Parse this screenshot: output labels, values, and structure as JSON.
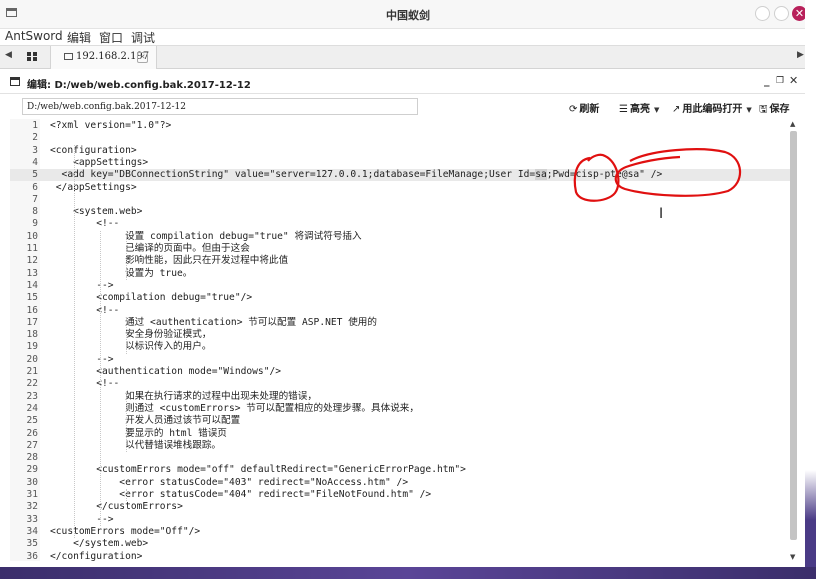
{
  "window": {
    "title": "中国蚁剑"
  },
  "menu": [
    "AntSword",
    "编辑",
    "窗口",
    "调试"
  ],
  "tabs": {
    "host": "192.168.2.197"
  },
  "editor": {
    "title": "编辑: D:/web/web.config.bak.2017-12-12",
    "min_label": "_",
    "max_label": "❐",
    "close_label": "✕",
    "path_value": "D:/web/web.config.bak.2017-12-12",
    "buttons": {
      "refresh": "刷新",
      "highlight": "高亮",
      "open_with_encoding": "用此编码打开",
      "save": "保存"
    },
    "line_numbers": [
      "1",
      "2",
      "3",
      "4",
      "5",
      "6",
      "7",
      "8",
      "9",
      "10",
      "11",
      "12",
      "13",
      "14",
      "15",
      "16",
      "17",
      "18",
      "19",
      "20",
      "21",
      "22",
      "23",
      "24",
      "25",
      "26",
      "27",
      "28",
      "29",
      "30",
      "31",
      "32",
      "33",
      "34",
      "35",
      "36"
    ],
    "lines": [
      "<?xml version=\"1.0\"?>",
      "",
      "<configuration>",
      "    <appSettings>",
      "  <add key=\"DBConnectionString\" value=\"server=127.0.0.1;database=FileManage;User Id=sa;Pwd=cisp-pte@sa\" />",
      " </appSettings>",
      "",
      "    <system.web>",
      "        <!--",
      "             设置 compilation debug=\"true\" 将调试符号插入",
      "             已编译的页面中。但由于这会",
      "             影响性能，因此只在开发过程中将此值",
      "             设置为 true。",
      "        -->",
      "        <compilation debug=\"true\"/>",
      "        <!--",
      "             通过 <authentication> 节可以配置 ASP.NET 使用的",
      "             安全身份验证模式，",
      "             以标识传入的用户。",
      "        -->",
      "        <authentication mode=\"Windows\"/>",
      "        <!--",
      "             如果在执行请求的过程中出现未处理的错误，",
      "             则通过 <customErrors> 节可以配置相应的处理步骤。具体说来，",
      "             开发人员通过该节可以配置",
      "             要显示的 html 错误页",
      "             以代替错误堆栈跟踪。",
      "",
      "        <customErrors mode=\"off\" defaultRedirect=\"GenericErrorPage.htm\">",
      "            <error statusCode=\"403\" redirect=\"NoAccess.htm\" />",
      "            <error statusCode=\"404\" redirect=\"FileNotFound.htm\" />",
      "        </customErrors>",
      "        -->",
      "<customErrors mode=\"Off\"/>",
      "    </system.web>",
      "</configuration>"
    ],
    "active_line": 5,
    "selection": "sa"
  },
  "colors": {
    "close_button": "#b8205a",
    "annotation": "#e01010",
    "active_line": "#e9e9e9"
  }
}
